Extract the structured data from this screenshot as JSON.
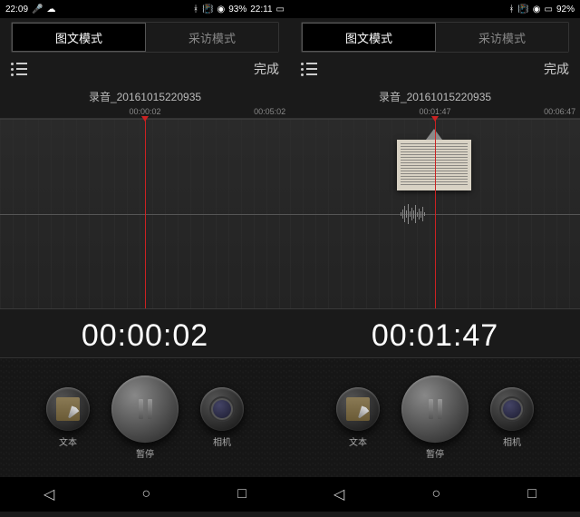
{
  "panes": [
    {
      "status": {
        "time": "22:09",
        "battery": "93%",
        "clock2": "22:11"
      },
      "tabs": {
        "left": "图文模式",
        "right": "采访模式"
      },
      "done": "完成",
      "title": "录音_20161015220935",
      "ruler": {
        "mid": "00:00:02",
        "end": "00:05:02"
      },
      "elapsed": "00:00:02",
      "buttons": {
        "text": "文本",
        "pause": "暂停",
        "camera": "相机"
      },
      "playhead_pct": 50,
      "has_thumb": false
    },
    {
      "status": {
        "time": "",
        "battery": "92%",
        "clock2": ""
      },
      "tabs": {
        "left": "图文模式",
        "right": "采访模式"
      },
      "done": "完成",
      "title": "录音_20161015220935",
      "ruler": {
        "mid": "00:01:47",
        "end": "00:06:47"
      },
      "elapsed": "00:01:47",
      "buttons": {
        "text": "文本",
        "pause": "暂停",
        "camera": "相机"
      },
      "playhead_pct": 50,
      "has_thumb": true
    }
  ]
}
